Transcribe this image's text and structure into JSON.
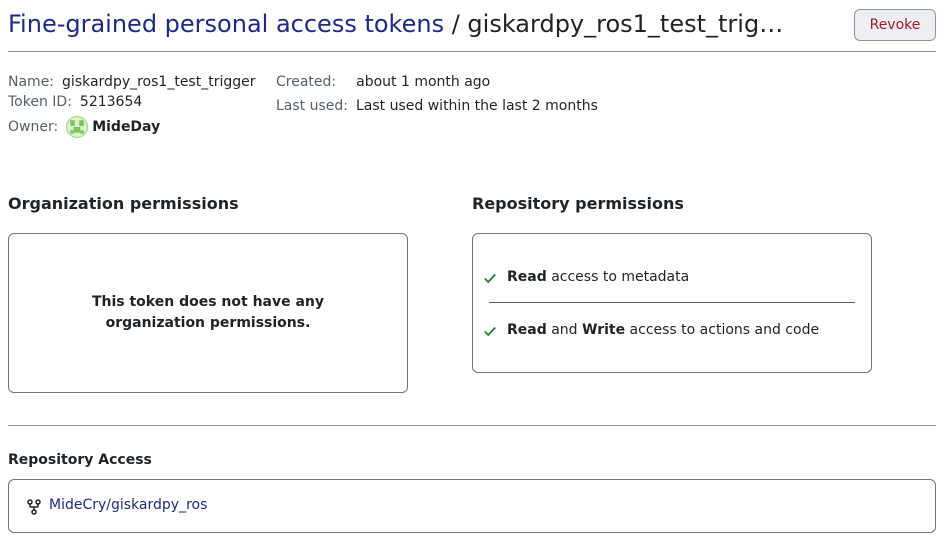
{
  "header": {
    "breadcrumb_link": "Fine-grained personal access tokens",
    "separator": " / ",
    "token_title": "giskardpy_ros1_test_trig…",
    "revoke_label": "Revoke"
  },
  "meta": {
    "name_label": "Name:",
    "name_value": "giskardpy_ros1_test_trigger",
    "token_id_label": "Token ID:",
    "token_id_value": "5213654",
    "owner_label": "Owner:",
    "owner_value": "MideDay",
    "created_label": "Created:",
    "created_value": "about 1 month ago",
    "last_used_label": "Last used:",
    "last_used_value": "Last used within the last 2 months"
  },
  "org_permissions": {
    "title": "Organization permissions",
    "empty_message": "This token does not have any organization permissions."
  },
  "repo_permissions": {
    "title": "Repository permissions",
    "items": [
      {
        "bold1": "Read",
        "mid": "",
        "bold2": "",
        "rest": " access to metadata"
      },
      {
        "bold1": "Read",
        "mid": " and ",
        "bold2": "Write",
        "rest": " access to actions and code"
      }
    ]
  },
  "repository_access": {
    "title": "Repository Access",
    "repo": "MideCry/giskardpy_ros"
  },
  "colors": {
    "link": "#1d2a86",
    "danger": "#a3192a",
    "check": "#1a7f37"
  }
}
